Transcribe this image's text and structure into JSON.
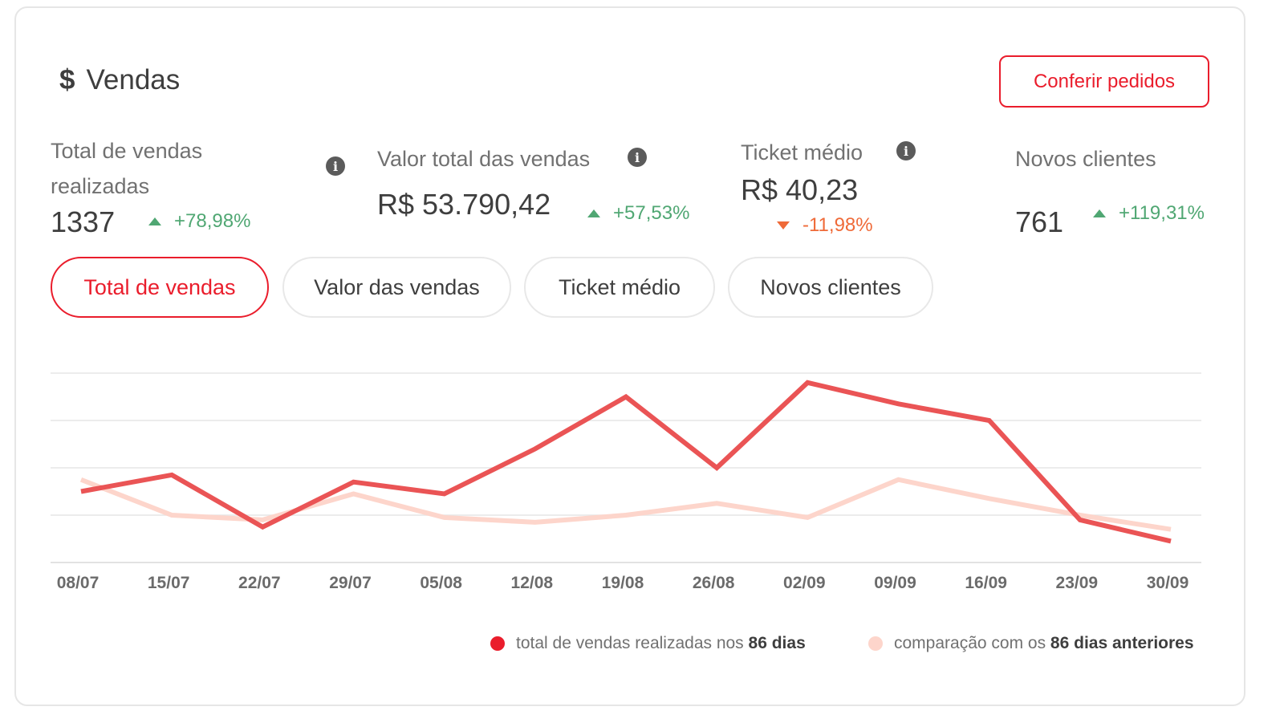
{
  "header": {
    "icon": "dollar-icon",
    "icon_glyph": "$",
    "title": "Vendas",
    "orders_button": "Conferir pedidos"
  },
  "metrics": [
    {
      "label_line1": "Total de vendas",
      "label_line2": "realizadas",
      "value": "1337",
      "delta": "+78,98%",
      "trend": "up"
    },
    {
      "label": "Valor total das vendas",
      "value": "R$ 53.790,42",
      "delta": "+57,53%",
      "trend": "up"
    },
    {
      "label": "Ticket médio",
      "value": "R$ 40,23",
      "delta": "-11,98%",
      "trend": "down"
    },
    {
      "label": "Novos clientes",
      "value": "761",
      "delta": "+119,31%",
      "trend": "up"
    }
  ],
  "info_glyph": "i",
  "tabs": [
    {
      "label": "Total de vendas",
      "active": true
    },
    {
      "label": "Valor das vendas",
      "active": false
    },
    {
      "label": "Ticket médio",
      "active": false
    },
    {
      "label": "Novos clientes",
      "active": false
    }
  ],
  "legend": {
    "current_prefix": "total de vendas realizadas nos ",
    "current_bold": "86 dias",
    "previous_prefix": "comparação com os ",
    "previous_bold": "86 dias anteriores"
  },
  "colors": {
    "accent": "#ea1d2c",
    "current_line": "#ea5455",
    "previous_line": "#fdd5cb",
    "positive": "#50a773",
    "negative": "#ef6a38"
  },
  "chart_data": {
    "type": "line",
    "categories": [
      "08/07",
      "15/07",
      "22/07",
      "29/07",
      "05/08",
      "12/08",
      "19/08",
      "26/08",
      "02/09",
      "09/09",
      "16/09",
      "23/09",
      "30/09"
    ],
    "series": [
      {
        "key": "current",
        "values": [
          30,
          37,
          15,
          34,
          29,
          48,
          70,
          40,
          76,
          67,
          60,
          18,
          9
        ]
      },
      {
        "key": "previous",
        "values": [
          35,
          20,
          18,
          29,
          19,
          17,
          20,
          25,
          19,
          35,
          27,
          20,
          14
        ]
      }
    ],
    "ylim": [
      0,
      80
    ],
    "grid": true
  }
}
